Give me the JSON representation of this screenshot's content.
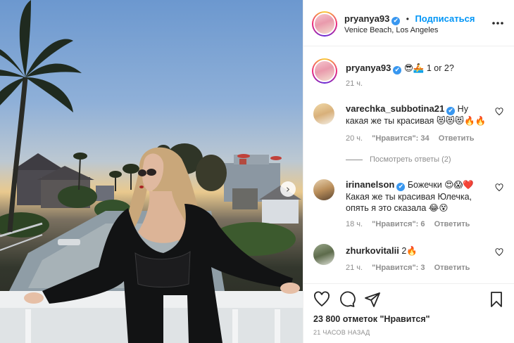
{
  "post": {
    "username": "pryanya93",
    "verified_mark": "✔",
    "separator": "•",
    "follow_label": "Подписаться",
    "location": "Venice Beach, Los Angeles",
    "more_icon": "more-horizontal-icon"
  },
  "caption": {
    "username": "pryanya93",
    "text": "😎🚣 1 or 2?",
    "time": "21 ч."
  },
  "comments": [
    {
      "username": "varechka_subbotina21",
      "verified": true,
      "text": "Ну какая же ты красивая 😻😻😻🔥🔥",
      "time": "20 ч.",
      "likes": "\"Нравится\": 34",
      "reply": "Ответить"
    },
    {
      "username": "irinanelson",
      "verified": true,
      "text": "Божечки 😍😱❤️ Какая же ты красивая Юлечка, опять я это сказала 😂😵",
      "time": "18 ч.",
      "likes": "\"Нравится\": 6",
      "reply": "Ответить"
    },
    {
      "username": "zhurkovitalii",
      "verified": false,
      "text": "2🔥",
      "time": "21 ч.",
      "likes": "\"Нравится\": 3",
      "reply": "Ответить"
    }
  ],
  "view_replies": "Посмотреть ответы (2)",
  "likes_total": "23 800 отметок \"Нравится\"",
  "posted_time": "21 ЧАСОВ НАЗАД",
  "carousel_next": "›",
  "colors": {
    "accent": "#0095f6",
    "verified": "#3897f0",
    "muted": "#8e8e8e",
    "text": "#262626"
  }
}
